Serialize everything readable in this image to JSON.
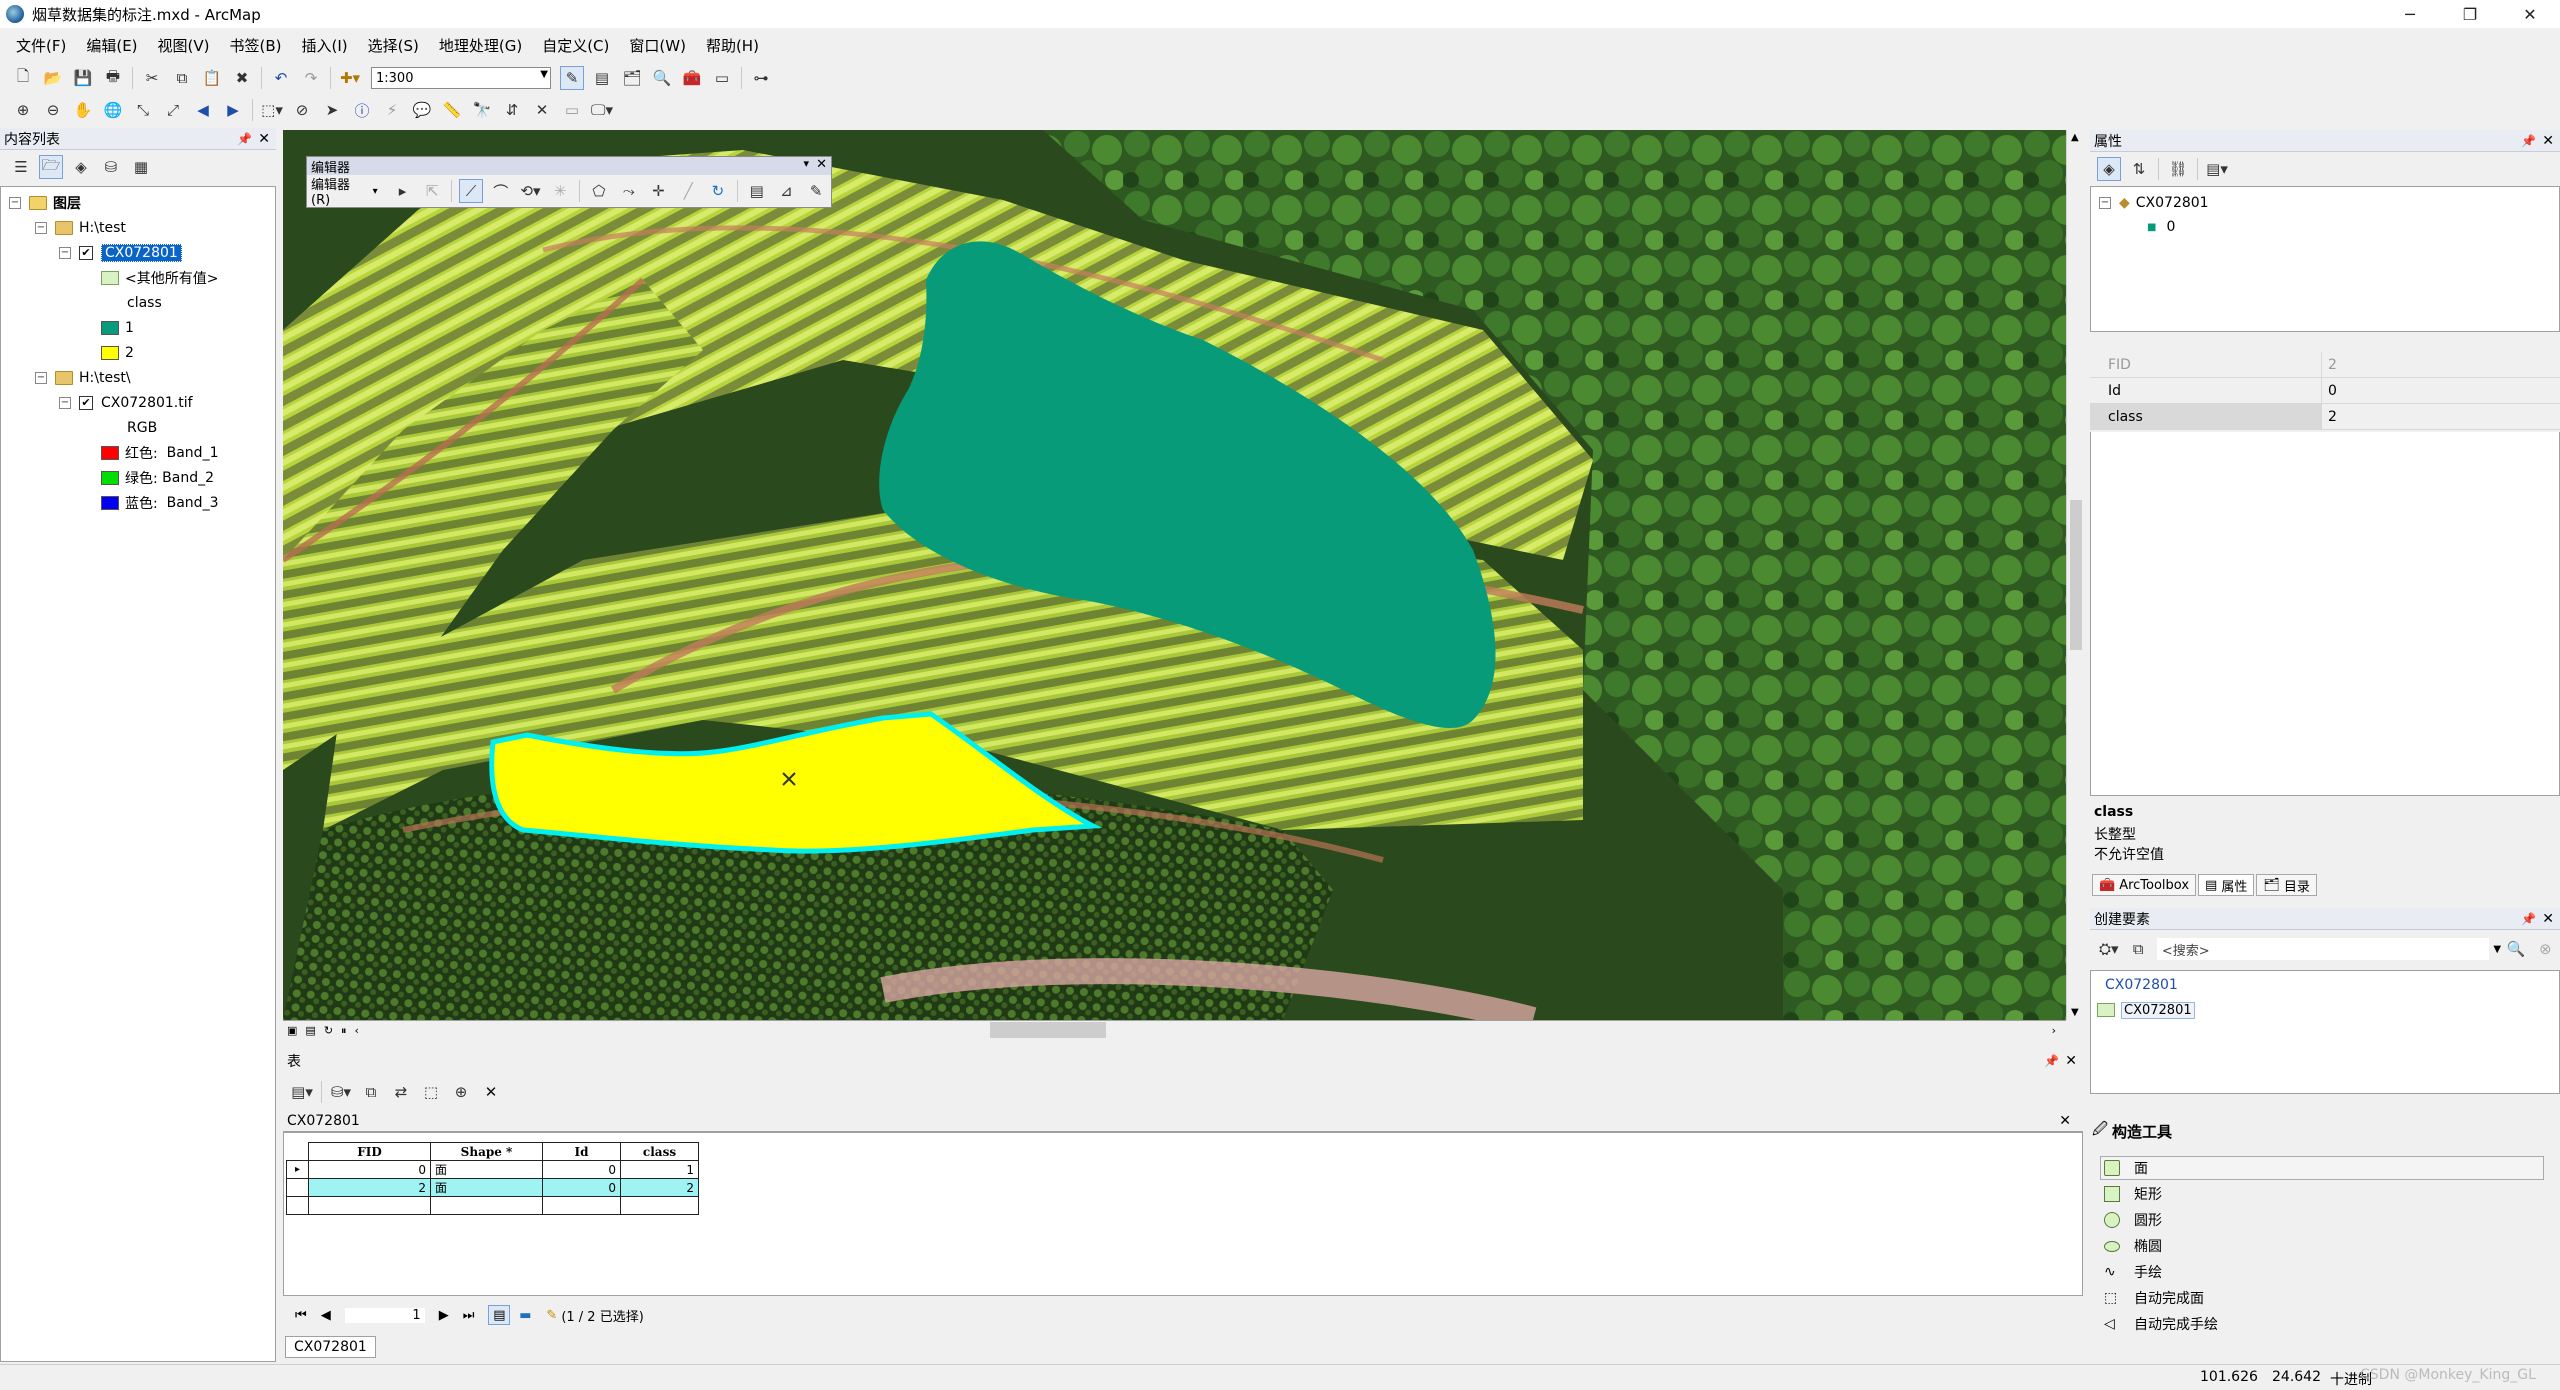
{
  "window": {
    "title": "烟草数据集的标注.mxd - ArcMap",
    "controls": {
      "minimize": "─",
      "restore": "❐",
      "close": "✕"
    }
  },
  "menu": [
    "文件(F)",
    "编辑(E)",
    "视图(V)",
    "书签(B)",
    "插入(I)",
    "选择(S)",
    "地理处理(G)",
    "自定义(C)",
    "窗口(W)",
    "帮助(H)"
  ],
  "toolbar": {
    "scale": "1:300"
  },
  "toc": {
    "title": "内容列表",
    "root_label": "图层",
    "groups": [
      {
        "path": "H:\\test",
        "layer": {
          "name": "CX072801",
          "other_values": "<其他所有值>",
          "field": "class",
          "classes": [
            {
              "label": "1",
              "color": "#079b79"
            },
            {
              "label": "2",
              "color": "#ffff00"
            }
          ]
        }
      },
      {
        "path": "H:\\test\\",
        "layer": {
          "name": "CX072801.tif",
          "field": "RGB",
          "bands": [
            {
              "label": "红色:",
              "band": "Band_1",
              "color": "#ff0000"
            },
            {
              "label": "绿色:",
              "band": "Band_2",
              "color": "#00dd00"
            },
            {
              "label": "蓝色:",
              "band": "Band_3",
              "color": "#0000ee"
            }
          ]
        }
      }
    ]
  },
  "editor_toolbar": {
    "title": "编辑器",
    "menu_label": "编辑器(R)"
  },
  "attributes_panel": {
    "title": "属性",
    "tree_root": "CX072801",
    "tree_child": "0",
    "rows": [
      {
        "key": "FID",
        "value": "2"
      },
      {
        "key": "Id",
        "value": "0"
      },
      {
        "key": "class",
        "value": "2"
      }
    ],
    "field_info": {
      "name": "class",
      "type": "长整型",
      "nullable": "不允许空值"
    },
    "tabs": [
      "ArcToolbox",
      "属性",
      "目录"
    ]
  },
  "create_features": {
    "title": "创建要素",
    "search_placeholder": "<搜索>",
    "template_group": "CX072801",
    "template_item": "CX072801"
  },
  "construction_tools": {
    "title": "构造工具",
    "items": [
      "面",
      "矩形",
      "圆形",
      "椭圆",
      "手绘",
      "自动完成面",
      "自动完成手绘"
    ]
  },
  "table": {
    "panel_title": "表",
    "tab_name": "CX072801",
    "columns": [
      "FID",
      "Shape *",
      "Id",
      "class"
    ],
    "rows": [
      [
        "0",
        "面",
        "0",
        "1"
      ],
      [
        "2",
        "面",
        "0",
        "2"
      ]
    ],
    "record": "1",
    "selection_text": "(1 / 2 已选择)",
    "bottom_tab": "CX072801"
  },
  "map": {
    "polygon_class1_color": "#079b79",
    "polygon_class2_color": "#ffff00",
    "selection_outline": "#00ffff"
  },
  "status": {
    "x": "101.626",
    "y": "24.642",
    "units": "十进制",
    "watermark": "CSDN @Monkey_King_GL"
  }
}
